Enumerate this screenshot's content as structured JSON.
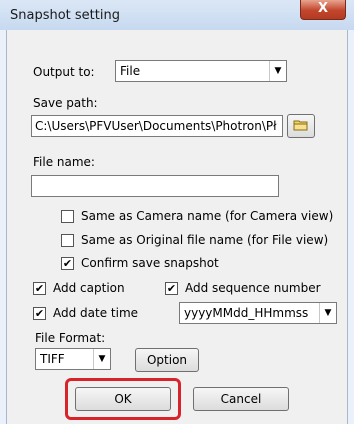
{
  "window": {
    "title": "Snapshot setting",
    "close_glyph": "X"
  },
  "output": {
    "label": "Output to:",
    "value": "File"
  },
  "save_path": {
    "label": "Save path:",
    "value": "C:\\Users\\PFVUser\\Documents\\Photron\\Pł"
  },
  "file_name": {
    "label": "File name:",
    "value": ""
  },
  "options": {
    "same_as_camera": {
      "label": "Same as Camera name (for Camera view)",
      "checked": false
    },
    "same_as_original": {
      "label": "Same as Original file name (for File view)",
      "checked": false
    },
    "confirm_save": {
      "label": "Confirm save snapshot",
      "checked": true
    },
    "add_caption": {
      "label": "Add caption",
      "checked": true
    },
    "add_sequence": {
      "label": "Add sequence number",
      "checked": true
    },
    "add_date_time": {
      "label": "Add date time",
      "checked": true
    }
  },
  "date_format": {
    "value": "yyyyMMdd_HHmmss"
  },
  "file_format": {
    "label": "File Format:",
    "value": "TIFF"
  },
  "buttons": {
    "option": "Option",
    "ok": "OK",
    "cancel": "Cancel"
  },
  "colors": {
    "highlight": "#d9232b",
    "close_button": "#c2462c"
  }
}
